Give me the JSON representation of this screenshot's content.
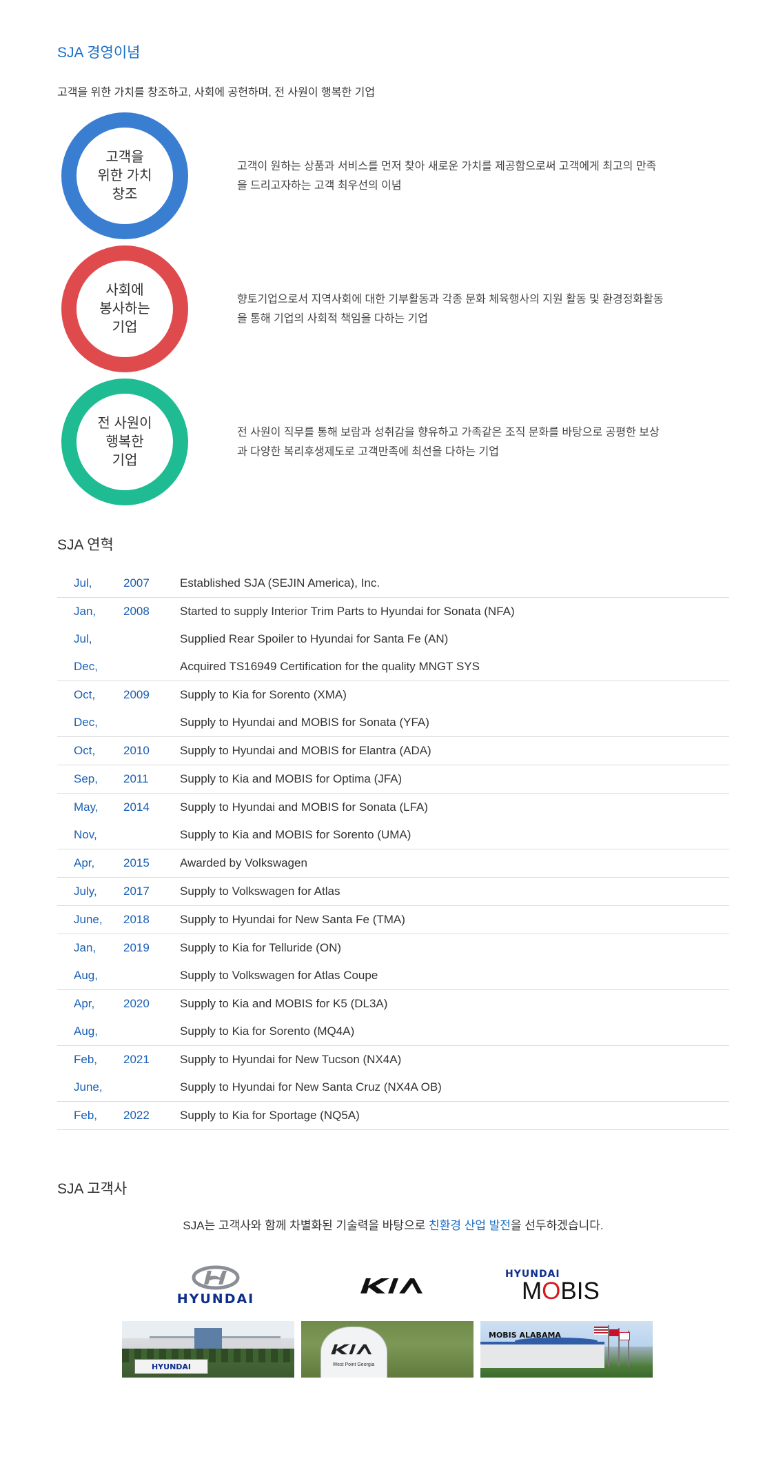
{
  "philosophy": {
    "title": "SJA 경영이념",
    "intro": "고객을 위한 가치를 창조하고, 사회에 공헌하며, 전 사원이 행복한 기업",
    "values": [
      {
        "label": "고객을\n위한 가치\n창조",
        "color": "#3a7ed2",
        "desc": "고객이 원하는 상품과 서비스를 먼저 찾아 새로운 가치를 제공함으로써 고객에게 최고의 만족을 드리고자하는 고객 최우선의 이념"
      },
      {
        "label": "사회에\n봉사하는\n기업",
        "color": "#df4a4d",
        "desc": "향토기업으로서 지역사회에 대한 기부활동과 각종 문화 체육행사의 지원 활동 및 환경정화활동을 통해 기업의 사회적 책임을 다하는 기업"
      },
      {
        "label": "전 사원이\n행복한\n기업",
        "color": "#1fbb93",
        "desc": "전 사원이 직무를 통해 보람과 성취감을 향유하고 가족같은 조직 문화를 바탕으로 공평한 보상과 다양한 복리후생제도로 고객만족에 최선을 다하는 기업"
      }
    ]
  },
  "history": {
    "title": "SJA 연혁",
    "rows": [
      {
        "month": "Jul,",
        "year": "2007",
        "text": "Established SJA (SEJIN America), Inc."
      },
      {
        "month": "Jan,",
        "year": "2008",
        "text": "Started to supply Interior Trim Parts to Hyundai for Sonata (NFA)"
      },
      {
        "month": "Jul,",
        "year": "",
        "text": "Supplied Rear Spoiler to Hyundai for Santa Fe (AN)"
      },
      {
        "month": "Dec,",
        "year": "",
        "text": "Acquired TS16949 Certification for the quality MNGT SYS"
      },
      {
        "month": "Oct,",
        "year": "2009",
        "text": "Supply to Kia for Sorento (XMA)"
      },
      {
        "month": "Dec,",
        "year": "",
        "text": "Supply to Hyundai and MOBIS for Sonata (YFA)"
      },
      {
        "month": "Oct,",
        "year": "2010",
        "text": "Supply to Hyundai and MOBIS for Elantra (ADA)"
      },
      {
        "month": "Sep,",
        "year": "2011",
        "text": "Supply to Kia and MOBIS for Optima (JFA)"
      },
      {
        "month": "May,",
        "year": "2014",
        "text": "Supply to Hyundai and MOBIS for Sonata (LFA)"
      },
      {
        "month": "Nov,",
        "year": "",
        "text": "Supply to Kia and MOBIS for Sorento (UMA)"
      },
      {
        "month": "Apr,",
        "year": "2015",
        "text": "Awarded by Volkswagen"
      },
      {
        "month": "July,",
        "year": "2017",
        "text": "Supply to Volkswagen for Atlas"
      },
      {
        "month": "June,",
        "year": "2018",
        "text": "Supply to Hyundai for New Santa Fe (TMA)"
      },
      {
        "month": "Jan,",
        "year": "2019",
        "text": "Supply to Kia for Telluride (ON)"
      },
      {
        "month": "Aug,",
        "year": "",
        "text": "Supply to Volkswagen for Atlas Coupe"
      },
      {
        "month": "Apr,",
        "year": "2020",
        "text": "Supply to Kia and MOBIS for K5 (DL3A)"
      },
      {
        "month": "Aug,",
        "year": "",
        "text": "Supply to Kia for Sorento (MQ4A)"
      },
      {
        "month": "Feb,",
        "year": "2021",
        "text": "Supply to Hyundai for New Tucson (NX4A)"
      },
      {
        "month": "June,",
        "year": "",
        "text": "Supply to Hyundai for New Santa Cruz (NX4A OB)"
      },
      {
        "month": "Feb,",
        "year": "2022",
        "text": "Supply to Kia for Sportage (NQ5A)"
      }
    ]
  },
  "customers": {
    "title": "SJA 고객사",
    "subtitle_pre": "SJA는 고객사와 함께 차별화된 기술력을 바탕으로 ",
    "subtitle_highlight": "친환경 산업 발전",
    "subtitle_post": "을 선두하겠습니다.",
    "logos": {
      "hyundai": "HYUNDAI",
      "kia": "KIA",
      "mobis_top": "HYUNDAI",
      "mobis_main": "MOBIS"
    },
    "photos": {
      "hyundai_sign": "HYUNDAI",
      "kia_tower_sub": "West Point Georgia",
      "mobis_sign": "MOBIS ALABAMA"
    }
  }
}
